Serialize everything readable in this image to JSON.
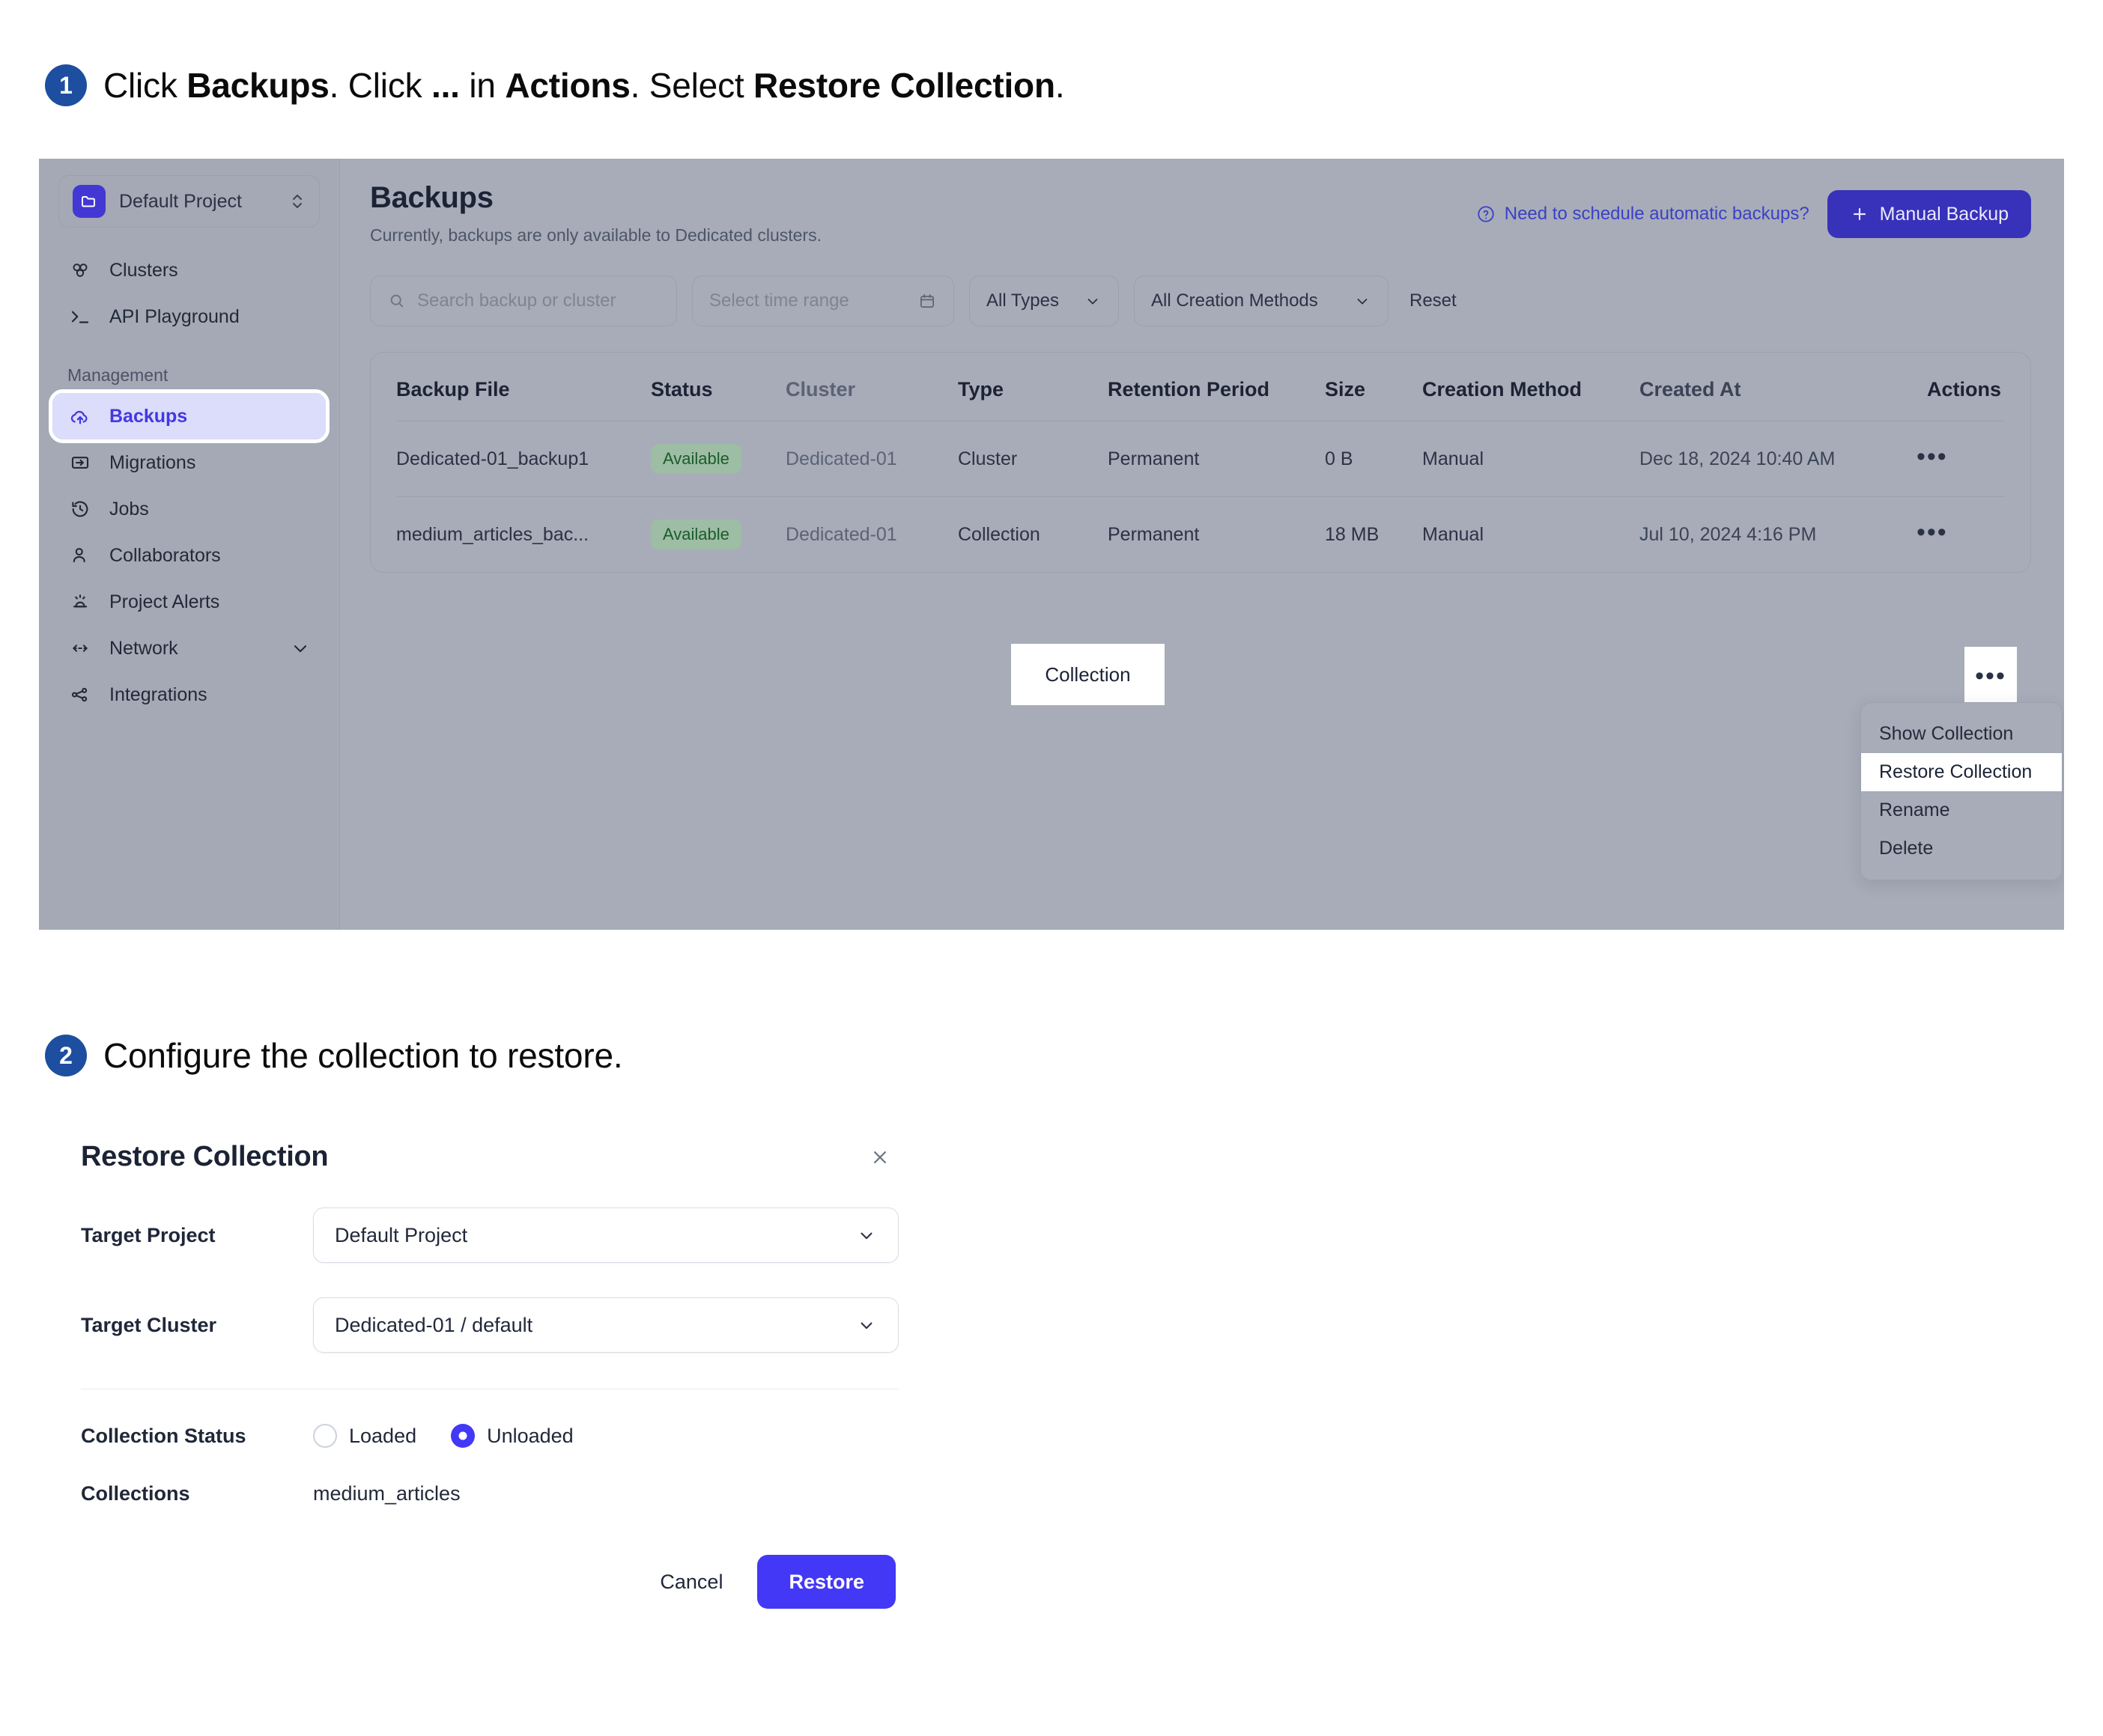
{
  "steps": [
    {
      "number": "1",
      "parts": [
        {
          "text": "Click ",
          "bold": false
        },
        {
          "text": "Backups",
          "bold": true
        },
        {
          "text": ". Click ",
          "bold": false
        },
        {
          "text": "...",
          "bold": true
        },
        {
          "text": " in ",
          "bold": false
        },
        {
          "text": "Actions",
          "bold": true
        },
        {
          "text": ". Select ",
          "bold": false
        },
        {
          "text": "Restore Collection",
          "bold": true
        },
        {
          "text": ".",
          "bold": false
        }
      ]
    },
    {
      "number": "2",
      "parts": [
        {
          "text": "Configure the collection to restore.",
          "bold": false
        }
      ]
    }
  ],
  "app": {
    "sidebar": {
      "project": {
        "name": "Default Project",
        "icon": "folder-icon",
        "chevron": "up-down-chevron-icon"
      },
      "top_items": [
        {
          "label": "Clusters",
          "icon": "clusters-icon"
        },
        {
          "label": "API Playground",
          "icon": "terminal-prompt-icon"
        }
      ],
      "section_label": "Management",
      "items": [
        {
          "label": "Backups",
          "icon": "cloud-upload-icon",
          "active": true
        },
        {
          "label": "Migrations",
          "icon": "migration-arrow-icon",
          "active": false
        },
        {
          "label": "Jobs",
          "icon": "clock-rewind-icon",
          "active": false
        },
        {
          "label": "Collaborators",
          "icon": "user-icon",
          "active": false
        },
        {
          "label": "Project Alerts",
          "icon": "alarm-light-icon",
          "active": false
        },
        {
          "label": "Network",
          "icon": "network-arrows-icon",
          "active": false,
          "chevron": "chevron-down-icon"
        },
        {
          "label": "Integrations",
          "icon": "share-nodes-icon",
          "active": false
        }
      ]
    },
    "header": {
      "title": "Backups",
      "subtitle": "Currently, backups are only available to Dedicated clusters.",
      "help_link": "Need to schedule automatic backups?",
      "help_icon": "question-circle-icon",
      "manual_backup_button": "Manual Backup",
      "manual_backup_icon": "plus-icon"
    },
    "filters": {
      "search_placeholder": "Search backup or cluster",
      "search_icon": "search-icon",
      "time_range_placeholder": "Select time range",
      "calendar_icon": "calendar-icon",
      "types_value": "All Types",
      "methods_value": "All Creation Methods",
      "chevron_icon": "chevron-down-icon",
      "reset_label": "Reset"
    },
    "table": {
      "columns": [
        "Backup File",
        "Status",
        "Cluster",
        "Type",
        "Retention Period",
        "Size",
        "Creation Method",
        "Created At",
        "Actions"
      ],
      "rows": [
        {
          "backup_file": "Dedicated-01_backup1",
          "status": "Available",
          "cluster": "Dedicated-01",
          "type": "Cluster",
          "retention_period": "Permanent",
          "size": "0 B",
          "creation_method": "Manual",
          "created_at": "Dec 18, 2024 10:40 AM",
          "actions": "•••"
        },
        {
          "backup_file": "medium_articles_bac...",
          "status": "Available",
          "cluster": "Dedicated-01",
          "type": "Collection",
          "retention_period": "Permanent",
          "size": "18 MB",
          "creation_method": "Manual",
          "created_at": "Jul 10, 2024 4:16 PM",
          "actions": "•••"
        }
      ],
      "highlight_type": "Collection",
      "highlight_actions": "•••"
    },
    "actions_menu": {
      "items": [
        {
          "label": "Show Collection",
          "selected": false
        },
        {
          "label": "Restore Collection",
          "selected": true
        },
        {
          "label": "Rename",
          "selected": false
        },
        {
          "label": "Delete",
          "selected": false
        }
      ]
    }
  },
  "dialog": {
    "title": "Restore Collection",
    "close_icon": "close-icon",
    "target_project_label": "Target Project",
    "target_project_value": "Default Project",
    "target_cluster_label": "Target Cluster",
    "target_cluster_value": "Dedicated-01 / default",
    "collection_status_label": "Collection Status",
    "status_options": [
      {
        "label": "Loaded",
        "selected": false
      },
      {
        "label": "Unloaded",
        "selected": true
      }
    ],
    "collections_label": "Collections",
    "collections_value": "medium_articles",
    "cancel_label": "Cancel",
    "restore_label": "Restore"
  },
  "colors": {
    "accent": "#4338f5",
    "panel_bg": "#a7acb8",
    "badge_text": "#1c5c2c",
    "step_badge": "#1d4ea0"
  }
}
